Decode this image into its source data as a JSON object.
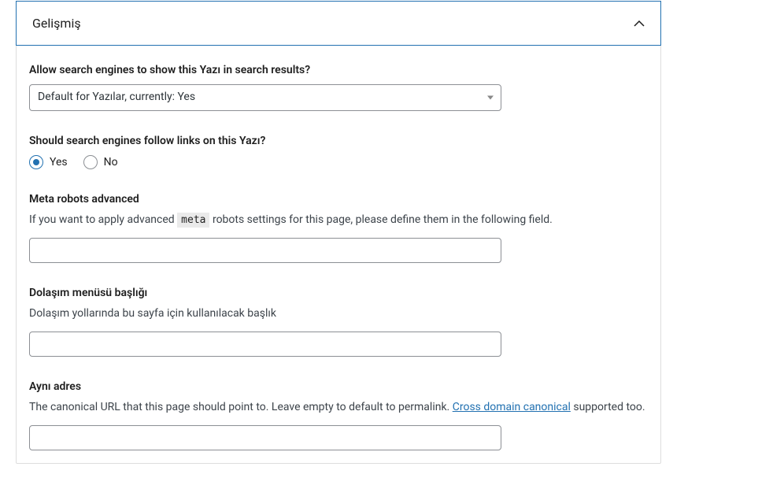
{
  "panel": {
    "title": "Gelişmiş"
  },
  "allow_search": {
    "label": "Allow search engines to show this Yazı in search results?",
    "selected": "Default for Yazılar, currently: Yes"
  },
  "follow_links": {
    "label": "Should search engines follow links on this Yazı?",
    "yes": "Yes",
    "no": "No"
  },
  "meta_robots": {
    "label": "Meta robots advanced",
    "desc_before": "If you want to apply advanced ",
    "code": "meta",
    "desc_after": " robots settings for this page, please define them in the following field."
  },
  "breadcrumb": {
    "label": "Dolaşım menüsü başlığı",
    "desc": "Dolaşım yollarında bu sayfa için kullanılacak başlık"
  },
  "canonical": {
    "label": "Aynı adres",
    "desc_before": "The canonical URL that this page should point to. Leave empty to default to permalink. ",
    "link_text": "Cross domain canonical",
    "desc_after": " supported too."
  }
}
